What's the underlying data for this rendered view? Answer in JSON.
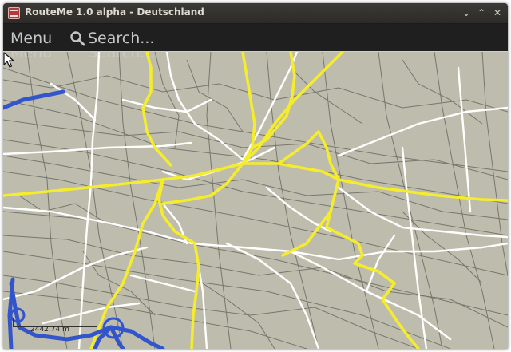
{
  "window": {
    "title": "RouteMe 1.0 alpha - Deutschland",
    "controls": {
      "minimize": "⌄",
      "maximize": "⌃",
      "close": "✕"
    }
  },
  "toolbar": {
    "menu_label": "Menu",
    "search_label": "Search...",
    "search_icon": "magnifier-icon"
  },
  "map": {
    "scale_label": "2442.74 m",
    "colors": {
      "background": "#bdbcad",
      "minor_road": "#6f6f67",
      "street": "#ffffff",
      "main_road": "#f4ec2c",
      "motorway": "#3355cc"
    }
  }
}
